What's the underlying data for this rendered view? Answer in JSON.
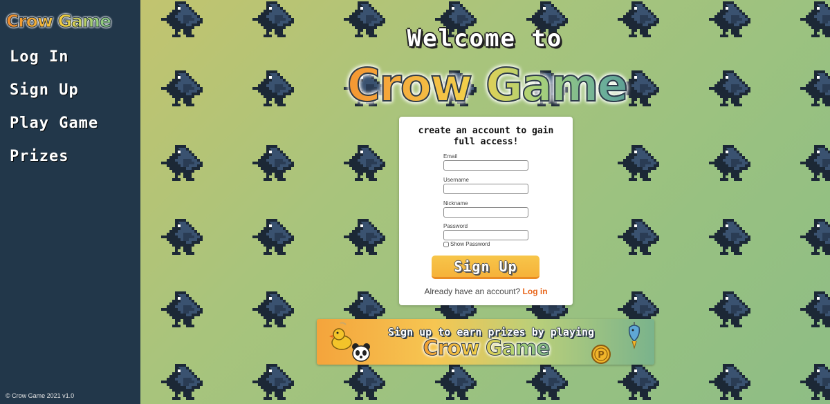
{
  "sidebar": {
    "logo": "Crow Game",
    "nav": [
      "Log In",
      "Sign Up",
      "Play Game",
      "Prizes"
    ],
    "copyright": "© Crow Game 2021 v1.0"
  },
  "hero": {
    "welcome": "Welcome to",
    "logo": "Crow Game"
  },
  "signup_card": {
    "title": "create an account to gain full access!",
    "fields": [
      {
        "label": "Email",
        "value": ""
      },
      {
        "label": "Username",
        "value": ""
      },
      {
        "label": "Nickname",
        "value": ""
      },
      {
        "label": "Password",
        "value": ""
      }
    ],
    "show_password_label": "Show Password",
    "show_password_checked": false,
    "submit_label": "Sign Up",
    "login_prompt": "Already have an account?",
    "login_link": "Log in"
  },
  "banner": {
    "text": "Sign up to earn prizes by playing",
    "logo": "Crow Game",
    "icons": [
      "duck-plush-icon",
      "panda-icon",
      "coin-icon",
      "fish-charm-icon"
    ]
  },
  "background": {
    "pattern_icon": "crow-icon"
  },
  "colors": {
    "sidebar_bg": "#22374a",
    "accent_orange": "#e8651a",
    "button_yellow": "#f6b23a",
    "crow_dark": "#2c3e55"
  }
}
